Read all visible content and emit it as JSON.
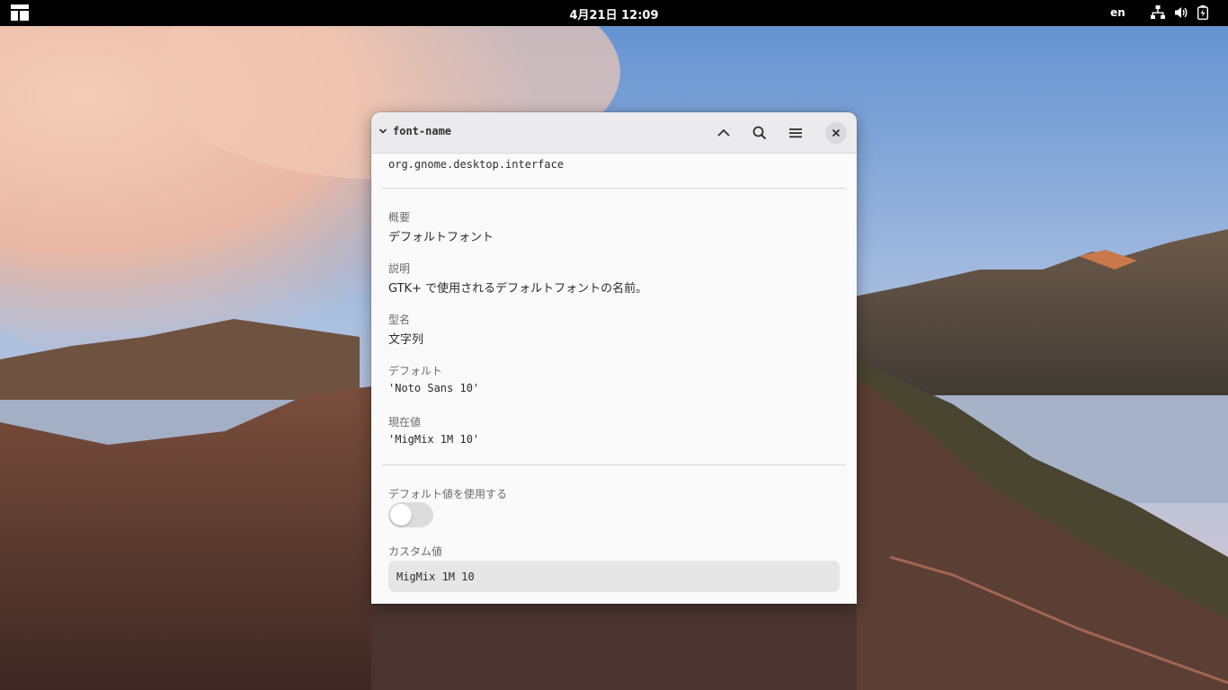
{
  "topbar": {
    "clock": "4月21日 12:09",
    "language": "en",
    "icons": [
      "activities-icon",
      "network-icon",
      "volume-icon",
      "battery-icon"
    ]
  },
  "window": {
    "title": "font-name",
    "schema": "org.gnome.desktop.interface",
    "summary_label": "概要",
    "summary_value": "デフォルトフォント",
    "description_label": "説明",
    "description_value": "GTK+ で使用されるデフォルトフォントの名前。",
    "type_label": "型名",
    "type_value": "文字列",
    "default_label": "デフォルト",
    "default_value": "'Noto Sans 10'",
    "current_label": "現在値",
    "current_value": "'MigMix 1M 10'",
    "use_default_label": "デフォルト値を使用する",
    "use_default_enabled": false,
    "custom_label": "カスタム値",
    "custom_value": "MigMix 1M 10"
  },
  "colors": {
    "topbar_bg": "#000000",
    "window_bg": "#fafafa",
    "headerbar_bg": "#ebebed",
    "input_bg": "#e6e6e6",
    "toggle_off": "#dcdcdc"
  }
}
